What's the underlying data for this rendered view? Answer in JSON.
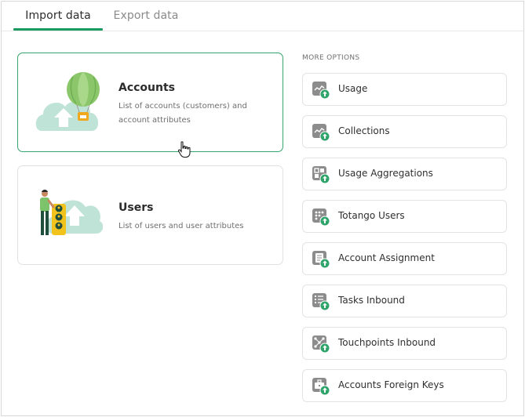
{
  "tabs": [
    {
      "label": "Import data",
      "active": true
    },
    {
      "label": "Export data",
      "active": false
    }
  ],
  "import_cards": [
    {
      "title": "Accounts",
      "description": "List of accounts (customers) and account attributes",
      "selected": true,
      "illustration": "cloud-upload-balloon-icon"
    },
    {
      "title": "Users",
      "description": "List of users and user attributes",
      "selected": false,
      "illustration": "cloud-upload-person-icon"
    }
  ],
  "more_options": {
    "heading": "MORE OPTIONS",
    "items": [
      {
        "label": "Usage",
        "icon": "usage-chart-icon"
      },
      {
        "label": "Collections",
        "icon": "collections-chart-icon"
      },
      {
        "label": "Usage Aggregations",
        "icon": "aggregation-blocks-icon"
      },
      {
        "label": "Totango Users",
        "icon": "users-dots-icon"
      },
      {
        "label": "Account Assignment",
        "icon": "document-icon"
      },
      {
        "label": "Tasks Inbound",
        "icon": "task-list-icon"
      },
      {
        "label": "Touchpoints Inbound",
        "icon": "network-nodes-icon"
      },
      {
        "label": "Accounts Foreign Keys",
        "icon": "briefcase-icon"
      }
    ]
  },
  "colors": {
    "accent": "#1a9a5e",
    "upload_badge": "#2ea36a",
    "icon_gray": "#8c8c8c",
    "cloud": "#bfe3d6",
    "balloon": "#8cc66b"
  }
}
